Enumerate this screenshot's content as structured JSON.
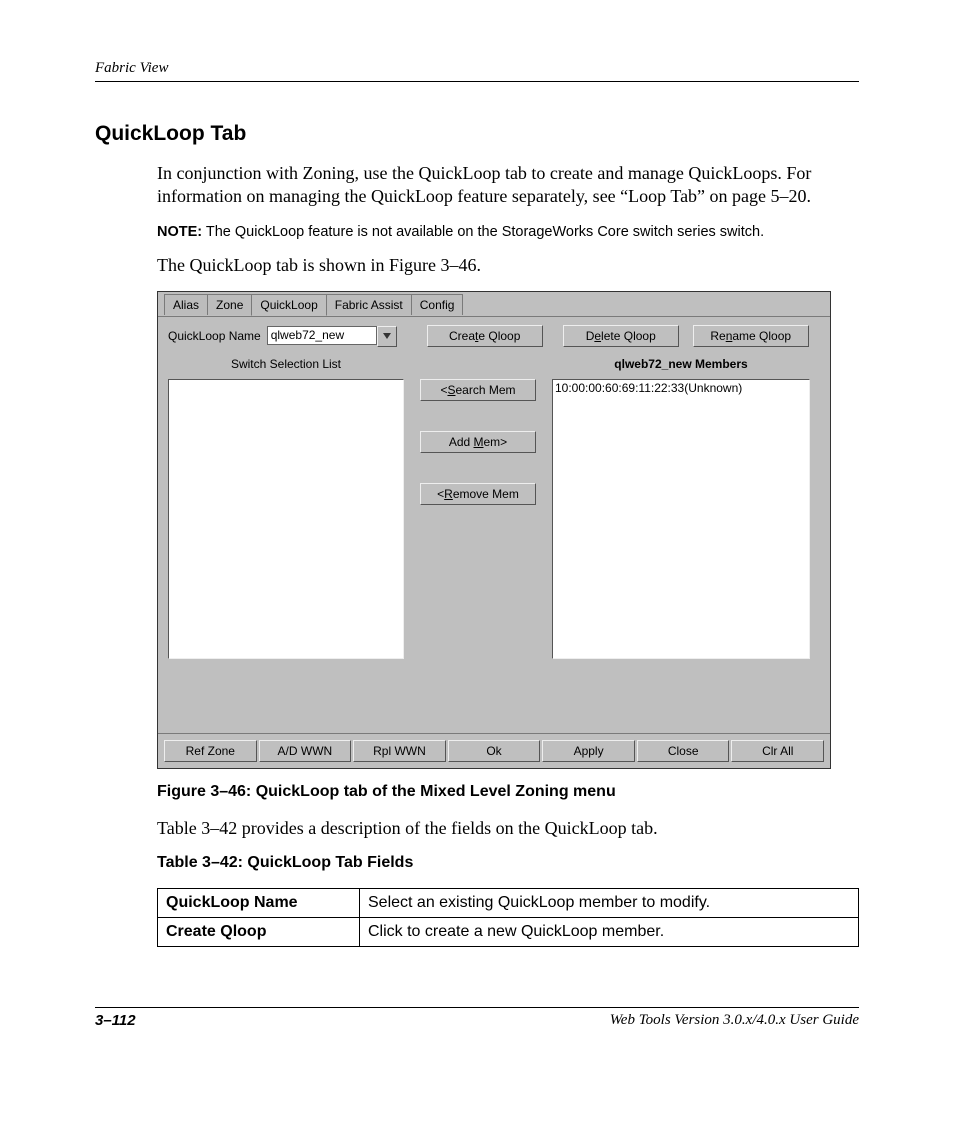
{
  "running_header": "Fabric View",
  "section_title": "QuickLoop Tab",
  "para1": "In conjunction with Zoning, use the QuickLoop tab to create and manage QuickLoops. For information on managing the QuickLoop feature separately, see “Loop Tab” on page 5–20.",
  "note_label": "NOTE:",
  "note_body": "  The QuickLoop feature is not available on the StorageWorks Core switch series switch.",
  "para2": "The QuickLoop tab is shown in Figure 3–46.",
  "figure_caption": "Figure 3–46:  QuickLoop tab of the Mixed Level Zoning menu",
  "para3": "Table 3–42 provides a description of the fields on the QuickLoop tab.",
  "table_caption": "Table 3–42:  QuickLoop Tab Fields",
  "table_rows": [
    {
      "name": "QuickLoop Name",
      "desc": "Select an existing QuickLoop member to modify."
    },
    {
      "name": "Create Qloop",
      "desc": "Click to create a new QuickLoop member."
    }
  ],
  "win": {
    "tabs": {
      "alias": "Alias",
      "zone": "Zone",
      "quickloop": "QuickLoop",
      "fabric_assist": "Fabric Assist",
      "config": "Config"
    },
    "name_label": "QuickLoop Name",
    "name_value": "qlweb72_new",
    "toolbar": {
      "create": "Create Qloop",
      "delete": "Delete Qloop",
      "rename": "Rename Qloop"
    },
    "left_header": "Switch Selection List",
    "right_header": "qlweb72_new Members",
    "mid": {
      "search": "<Search Mem",
      "add": "Add Mem>",
      "remove": "<Remove Mem"
    },
    "members": [
      "10:00:00:60:69:11:22:33(Unknown)"
    ],
    "bottom": {
      "refzone": "Ref Zone",
      "adwwn": "A/D WWN",
      "rplwwn": "Rpl WWN",
      "ok": "Ok",
      "apply": "Apply",
      "close": "Close",
      "clrall": "Clr All"
    }
  },
  "footer": {
    "page": "3–112",
    "guide": "Web Tools Version 3.0.x/4.0.x User Guide"
  }
}
